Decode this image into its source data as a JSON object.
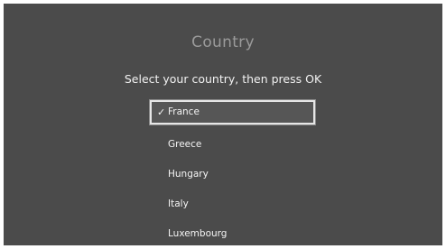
{
  "header": {
    "title": "Country",
    "instruction": "Select your country, then press OK"
  },
  "countries": {
    "items": [
      {
        "label": "France",
        "selected": true,
        "checked": true
      },
      {
        "label": "Greece",
        "selected": false,
        "checked": false
      },
      {
        "label": "Hungary",
        "selected": false,
        "checked": false
      },
      {
        "label": "Italy",
        "selected": false,
        "checked": false
      },
      {
        "label": "Luxembourg",
        "selected": false,
        "checked": false
      }
    ],
    "check_icon": "checkmark-icon"
  },
  "colors": {
    "background": "#4b4b4b",
    "title_text": "#9a9a9a",
    "text": "#f2f2f2",
    "selection_border": "#e6e6e6"
  }
}
